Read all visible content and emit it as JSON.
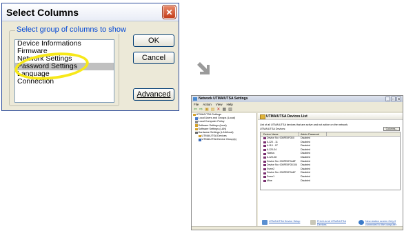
{
  "dialog": {
    "title": "Select Columns",
    "group_label": "Select group of columns to show",
    "items": [
      "Device Informations",
      "Firmware",
      "Network Settings",
      "Password Settings",
      "Language",
      "Connection"
    ],
    "selected_index": 3,
    "ok_label": "OK",
    "cancel_label": "Cancel",
    "advanced_label": "Advanced",
    "highlight_color": "#f7e81a",
    "close_icon": "close-icon"
  },
  "window": {
    "title": "Network UTMA/UTSA Settings",
    "menu": [
      "File",
      "Action",
      "View",
      "Help"
    ],
    "toolbar_icons": [
      "back-icon",
      "forward-icon",
      "up-icon",
      "folder-icon",
      "delete-icon",
      "print-icon",
      "properties-icon"
    ],
    "tree": [
      "UTMA/UTSA Settings",
      "Local Users and Groups (Local)",
      "Local Computer Policy",
      "Software Settings (local)",
      "Software Settings (LAN)",
      "Hardware Settings (LAN/local)",
      "UTMA/UTSA Devices",
      "UTMA/UTSA Device Group(s)"
    ],
    "main": {
      "header": "UTMA/UTSA Devices List",
      "description": "List of all UTMA/UTSA devices that are active and not active on the network.",
      "list_label": "UTMA/UTSA Devices:",
      "columns_button": "Columns...",
      "col1": "Device Name",
      "col2": "Admin Password",
      "rows": [
        {
          "name": "Device No: 000FE0F0D0",
          "status": "Disabled"
        },
        {
          "name": "IL120 - 11",
          "status": "Disabled"
        },
        {
          "name": "IL110 - 07",
          "status": "Disabled"
        },
        {
          "name": "IL120-04",
          "status": "Disabled"
        },
        {
          "name": "Haelus",
          "status": "Disabled"
        },
        {
          "name": "IL120-08",
          "status": "Disabled"
        },
        {
          "name": "Device No: 000FE0F0A8F",
          "status": "Disabled"
        },
        {
          "name": "Device No: 000FE0F0D104",
          "status": "Disabled"
        },
        {
          "name": "Svem2",
          "status": "Disabled"
        },
        {
          "name": "Device No: 000FE0F0A87",
          "status": "Disabled"
        },
        {
          "name": "Svem1",
          "status": "Disabled"
        },
        {
          "name": "Mine",
          "status": "Disabled"
        }
      ],
      "links": [
        {
          "label": "UTMA/UTSA Device Setup"
        },
        {
          "label": "Print List of UTMA/UTSA Devices"
        },
        {
          "label": "New station screen Only if connected to the computer"
        }
      ]
    }
  }
}
